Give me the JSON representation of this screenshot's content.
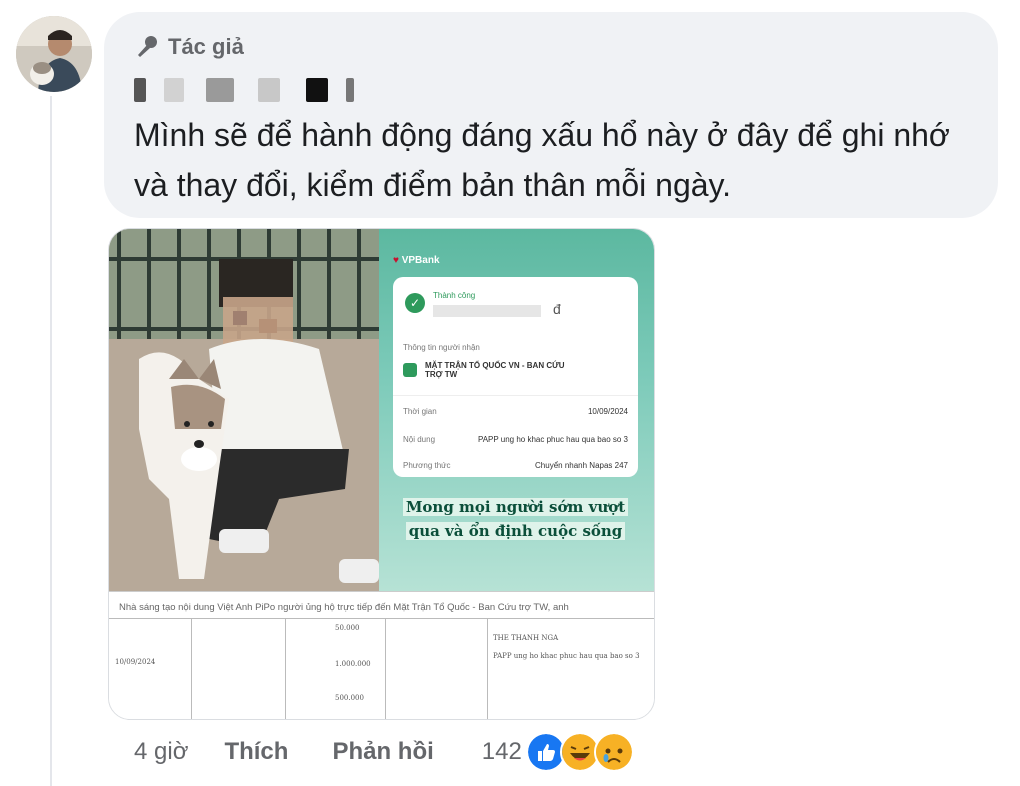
{
  "comment": {
    "author_badge": "Tác giả",
    "author_name_obscured": "",
    "text": "Mình sẽ để hành động đáng xấu hổ này ở đây để ghi nhớ và thay đổi, kiểm điểm bản thân mỗi ngày."
  },
  "attachment": {
    "bank_name": "VPBank",
    "status": "Thành công",
    "currency": "đ",
    "recipient_label": "Thông tin người nhận",
    "recipient": "MẶT TRẬN TỔ QUỐC VN - BAN CỨU TRỢ TW",
    "rows": [
      {
        "label": "Thời gian",
        "value": "10/09/2024"
      },
      {
        "label": "Nội dung",
        "value": "PAPP ung ho khac phuc hau qua bao so 3"
      },
      {
        "label": "Phương thức",
        "value": "Chuyển nhanh Napas 247"
      }
    ],
    "overlay_line1": "Mong mọi người sớm vượt",
    "overlay_line2": "qua và ổn định cuộc sống",
    "table_caption": "Nhà sáng tạo nội dung Việt Anh PiPo người ủng hộ trực tiếp đến Mặt Trận Tổ Quốc - Ban Cứu trợ TW, anh",
    "table_cells": [
      "50.000",
      "1.000.000",
      "500.000",
      "10/09/2024",
      "THE THANH NGA",
      "PAPP ung ho khac phuc hau qua bao so 3"
    ]
  },
  "actions": {
    "time": "4 giờ",
    "like": "Thích",
    "reply": "Phản hồi",
    "reaction_count": "142",
    "reaction_icons": [
      "like-icon",
      "haha-icon",
      "sad-icon"
    ]
  },
  "colors": {
    "bubble": "#f0f2f5",
    "like_blue": "#1877f2",
    "emoji_yellow": "#f7b125"
  }
}
